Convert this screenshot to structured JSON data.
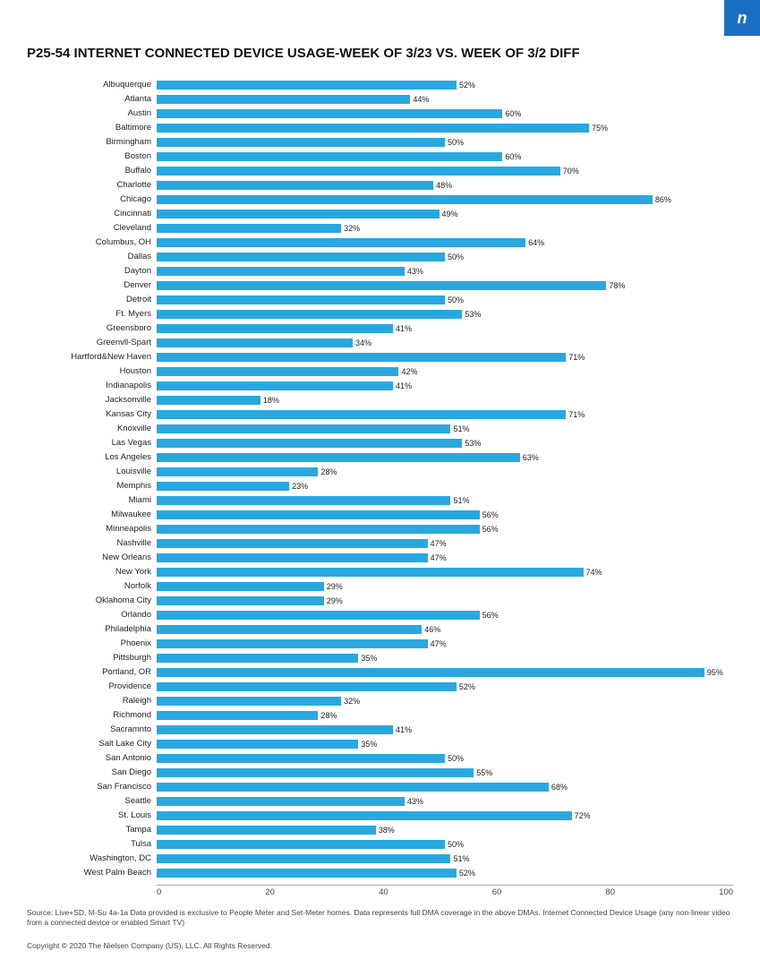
{
  "badge": "n",
  "title": "P25-54 INTERNET CONNECTED DEVICE USAGE-WEEK OF 3/23 VS. WEEK OF 3/2 DIFF",
  "chart_max": 100,
  "x_axis_labels": [
    "0",
    "20",
    "40",
    "60",
    "80",
    "100"
  ],
  "bars": [
    {
      "city": "Albuquerque",
      "value": 52
    },
    {
      "city": "Atlanta",
      "value": 44
    },
    {
      "city": "Austin",
      "value": 60
    },
    {
      "city": "Baltimore",
      "value": 75
    },
    {
      "city": "Birmingham",
      "value": 50
    },
    {
      "city": "Boston",
      "value": 60
    },
    {
      "city": "Buffalo",
      "value": 70
    },
    {
      "city": "Charlotte",
      "value": 48
    },
    {
      "city": "Chicago",
      "value": 86
    },
    {
      "city": "Cincinnati",
      "value": 49
    },
    {
      "city": "Cleveland",
      "value": 32
    },
    {
      "city": "Columbus, OH",
      "value": 64
    },
    {
      "city": "Dallas",
      "value": 50
    },
    {
      "city": "Dayton",
      "value": 43
    },
    {
      "city": "Denver",
      "value": 78
    },
    {
      "city": "Detroit",
      "value": 50
    },
    {
      "city": "Ft. Myers",
      "value": 53
    },
    {
      "city": "Greensboro",
      "value": 41
    },
    {
      "city": "Greenvll-Spart",
      "value": 34
    },
    {
      "city": "Hartford&New Haven",
      "value": 71
    },
    {
      "city": "Houston",
      "value": 42
    },
    {
      "city": "Indianapolis",
      "value": 41
    },
    {
      "city": "Jacksonville",
      "value": 18
    },
    {
      "city": "Kansas City",
      "value": 71
    },
    {
      "city": "Knoxville",
      "value": 51
    },
    {
      "city": "Las Vegas",
      "value": 53
    },
    {
      "city": "Los Angeles",
      "value": 63
    },
    {
      "city": "Louisville",
      "value": 28
    },
    {
      "city": "Memphis",
      "value": 23
    },
    {
      "city": "Miami",
      "value": 51
    },
    {
      "city": "Milwaukee",
      "value": 56
    },
    {
      "city": "Minneapolis",
      "value": 56
    },
    {
      "city": "Nashville",
      "value": 47
    },
    {
      "city": "New Orleans",
      "value": 47
    },
    {
      "city": "New York",
      "value": 74
    },
    {
      "city": "Norfolk",
      "value": 29
    },
    {
      "city": "Oklahoma City",
      "value": 29
    },
    {
      "city": "Orlando",
      "value": 56
    },
    {
      "city": "Philadelphia",
      "value": 46
    },
    {
      "city": "Phoenix",
      "value": 47
    },
    {
      "city": "Pittsburgh",
      "value": 35
    },
    {
      "city": "Portland, OR",
      "value": 95
    },
    {
      "city": "Providence",
      "value": 52
    },
    {
      "city": "Raleigh",
      "value": 32
    },
    {
      "city": "Richmond",
      "value": 28
    },
    {
      "city": "Sacramnto",
      "value": 41
    },
    {
      "city": "Salt Lake City",
      "value": 35
    },
    {
      "city": "San Antonio",
      "value": 50
    },
    {
      "city": "San Diego",
      "value": 55
    },
    {
      "city": "San Francisco",
      "value": 68
    },
    {
      "city": "Seattle",
      "value": 43
    },
    {
      "city": "St. Louis",
      "value": 72
    },
    {
      "city": "Tampa",
      "value": 38
    },
    {
      "city": "Tulsa",
      "value": 50
    },
    {
      "city": "Washington, DC",
      "value": 51
    },
    {
      "city": "West Palm Beach",
      "value": 52
    }
  ],
  "source": "Source: Live+SD, M-Su 4a-1a Data provided is exclusive to People Meter and Set-Meter homes. Data represents full DMA coverage in the above DMAs. Internet Connected Device Usage (any non-linear video from a connected device or enabled Smart TV)",
  "copyright": "Copyright © 2020 The Nielsen Company (US), LLC. All Rights Reserved."
}
